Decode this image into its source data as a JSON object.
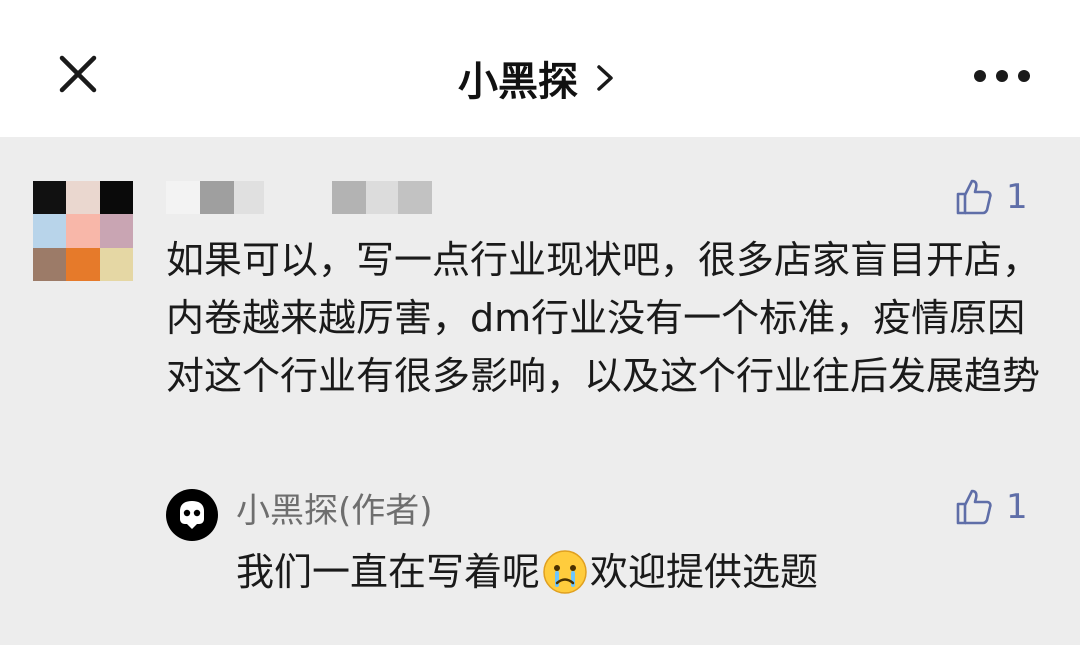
{
  "header": {
    "title": "小黑探",
    "close_icon": "close-icon",
    "chevron_icon": "chevron-right-icon",
    "more_icon": "more-horizontal-icon"
  },
  "comment": {
    "avatar_colors": [
      "#111111",
      "#ead7cf",
      "#0a0a0a",
      "#b8d4ea",
      "#f8b7a9",
      "#c9a5b3",
      "#9c7b68",
      "#e67a2a",
      "#e5d7a4"
    ],
    "text": "如果可以，写一点行业现状吧，很多店家盲目开店，内卷越来越厉害，dm行业没有一个标准，疫情原因对这个行业有很多影响，以及这个行业往后发展趋势",
    "likes": "1",
    "like_icon": "thumbs-up-icon"
  },
  "reply": {
    "author": "小黑探(作者)",
    "text_before": "我们一直在写着呢",
    "emoji": "crying-face-emoji",
    "text_after": "欢迎提供选题",
    "likes": "1"
  }
}
